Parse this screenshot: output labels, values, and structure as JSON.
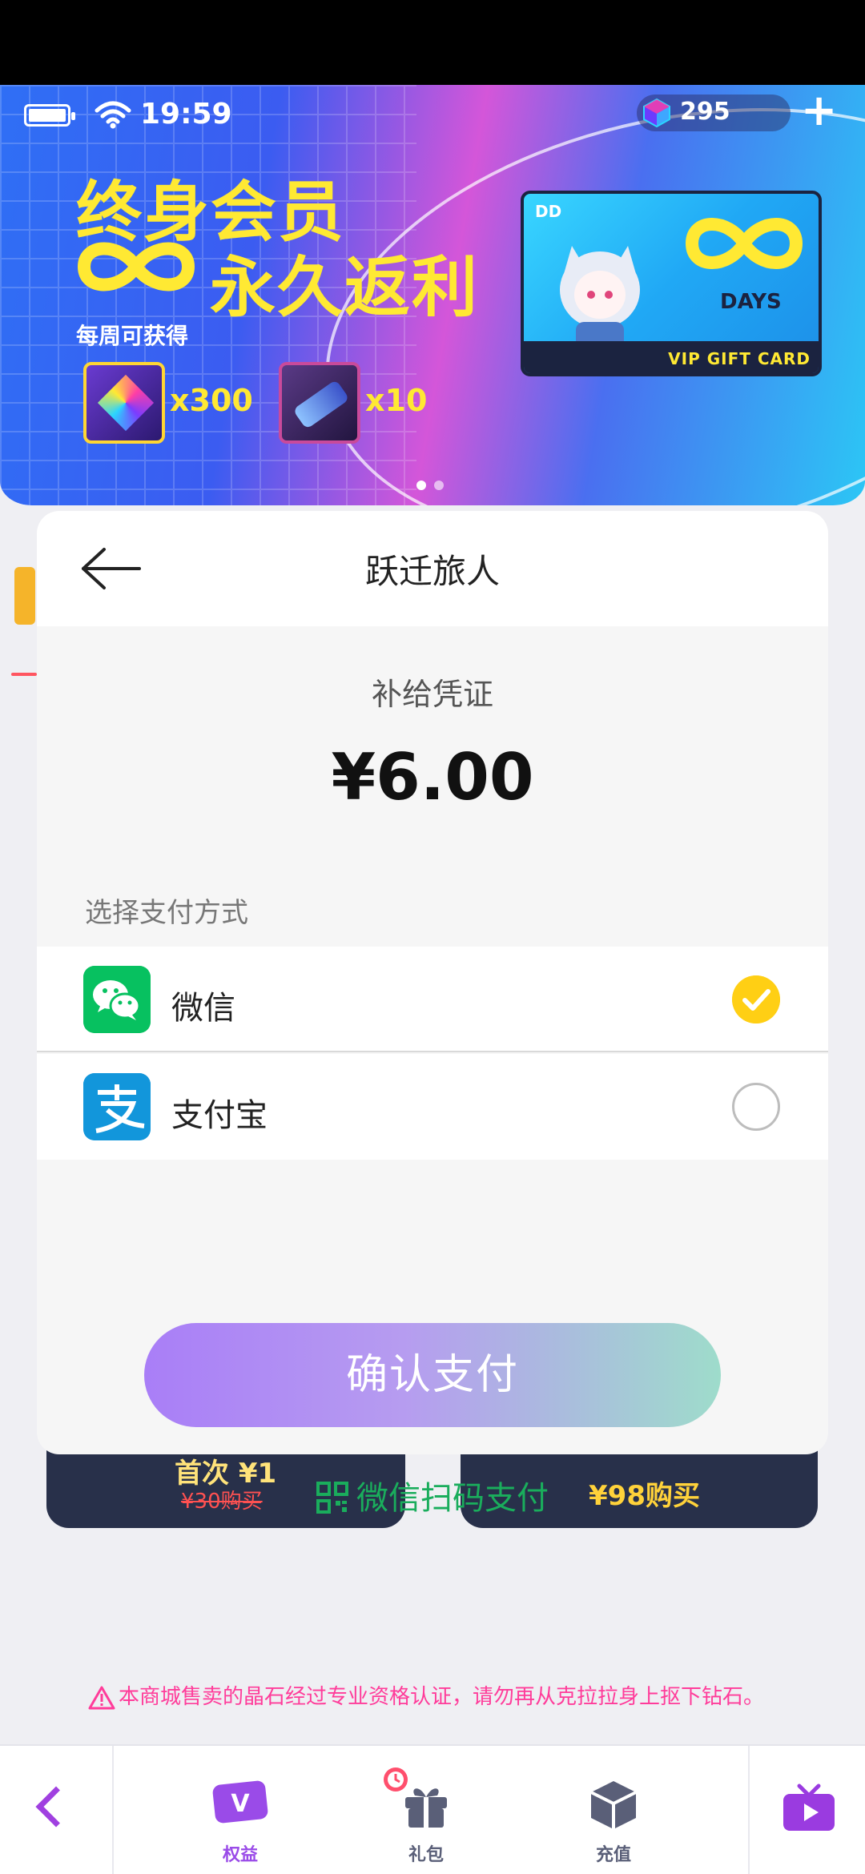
{
  "status_bar": {
    "time": "19:59"
  },
  "header": {
    "gem_count": "295",
    "add_label": "+"
  },
  "banner": {
    "headline_line1": "终身会员",
    "headline_line2": "永久返利",
    "weekly_label": "每周可获得",
    "rewards": [
      {
        "qty": "x300",
        "icon": "gem-icon"
      },
      {
        "qty": "x10",
        "icon": "ticket-icon"
      }
    ],
    "card": {
      "dd": "DD",
      "days": "DAYS",
      "label": "VIP GIFT CARD"
    },
    "page_dots": 2
  },
  "background_cards": [
    {
      "first_label": "首次 ¥1",
      "original_price": "¥30购买"
    },
    {
      "price_label": "¥98购买"
    }
  ],
  "payment_sheet": {
    "title": "跃迁旅人",
    "product": "补给凭证",
    "price": "¥6.00",
    "choose_label": "选择支付方式",
    "methods": [
      {
        "label": "微信",
        "icon": "wechat-icon",
        "selected": true
      },
      {
        "label": "支付宝",
        "icon": "alipay-icon",
        "selected": false
      }
    ],
    "confirm_label": "确认支付",
    "scan_label": "微信扫码支付"
  },
  "notice": "本商城售卖的晶石经过专业资格认证，请勿再从克拉拉身上抠下钻石。",
  "bottom_nav": {
    "items": [
      {
        "label": "权益",
        "icon": "vip-icon"
      },
      {
        "label": "礼包",
        "icon": "gift-icon"
      },
      {
        "label": "充值",
        "icon": "cube-icon"
      }
    ]
  },
  "colors": {
    "accent_purple": "#a97ef7",
    "accent_green": "#9edccb",
    "wechat": "#07c160",
    "alipay": "#1296db",
    "banner_yellow": "#ffe933"
  }
}
